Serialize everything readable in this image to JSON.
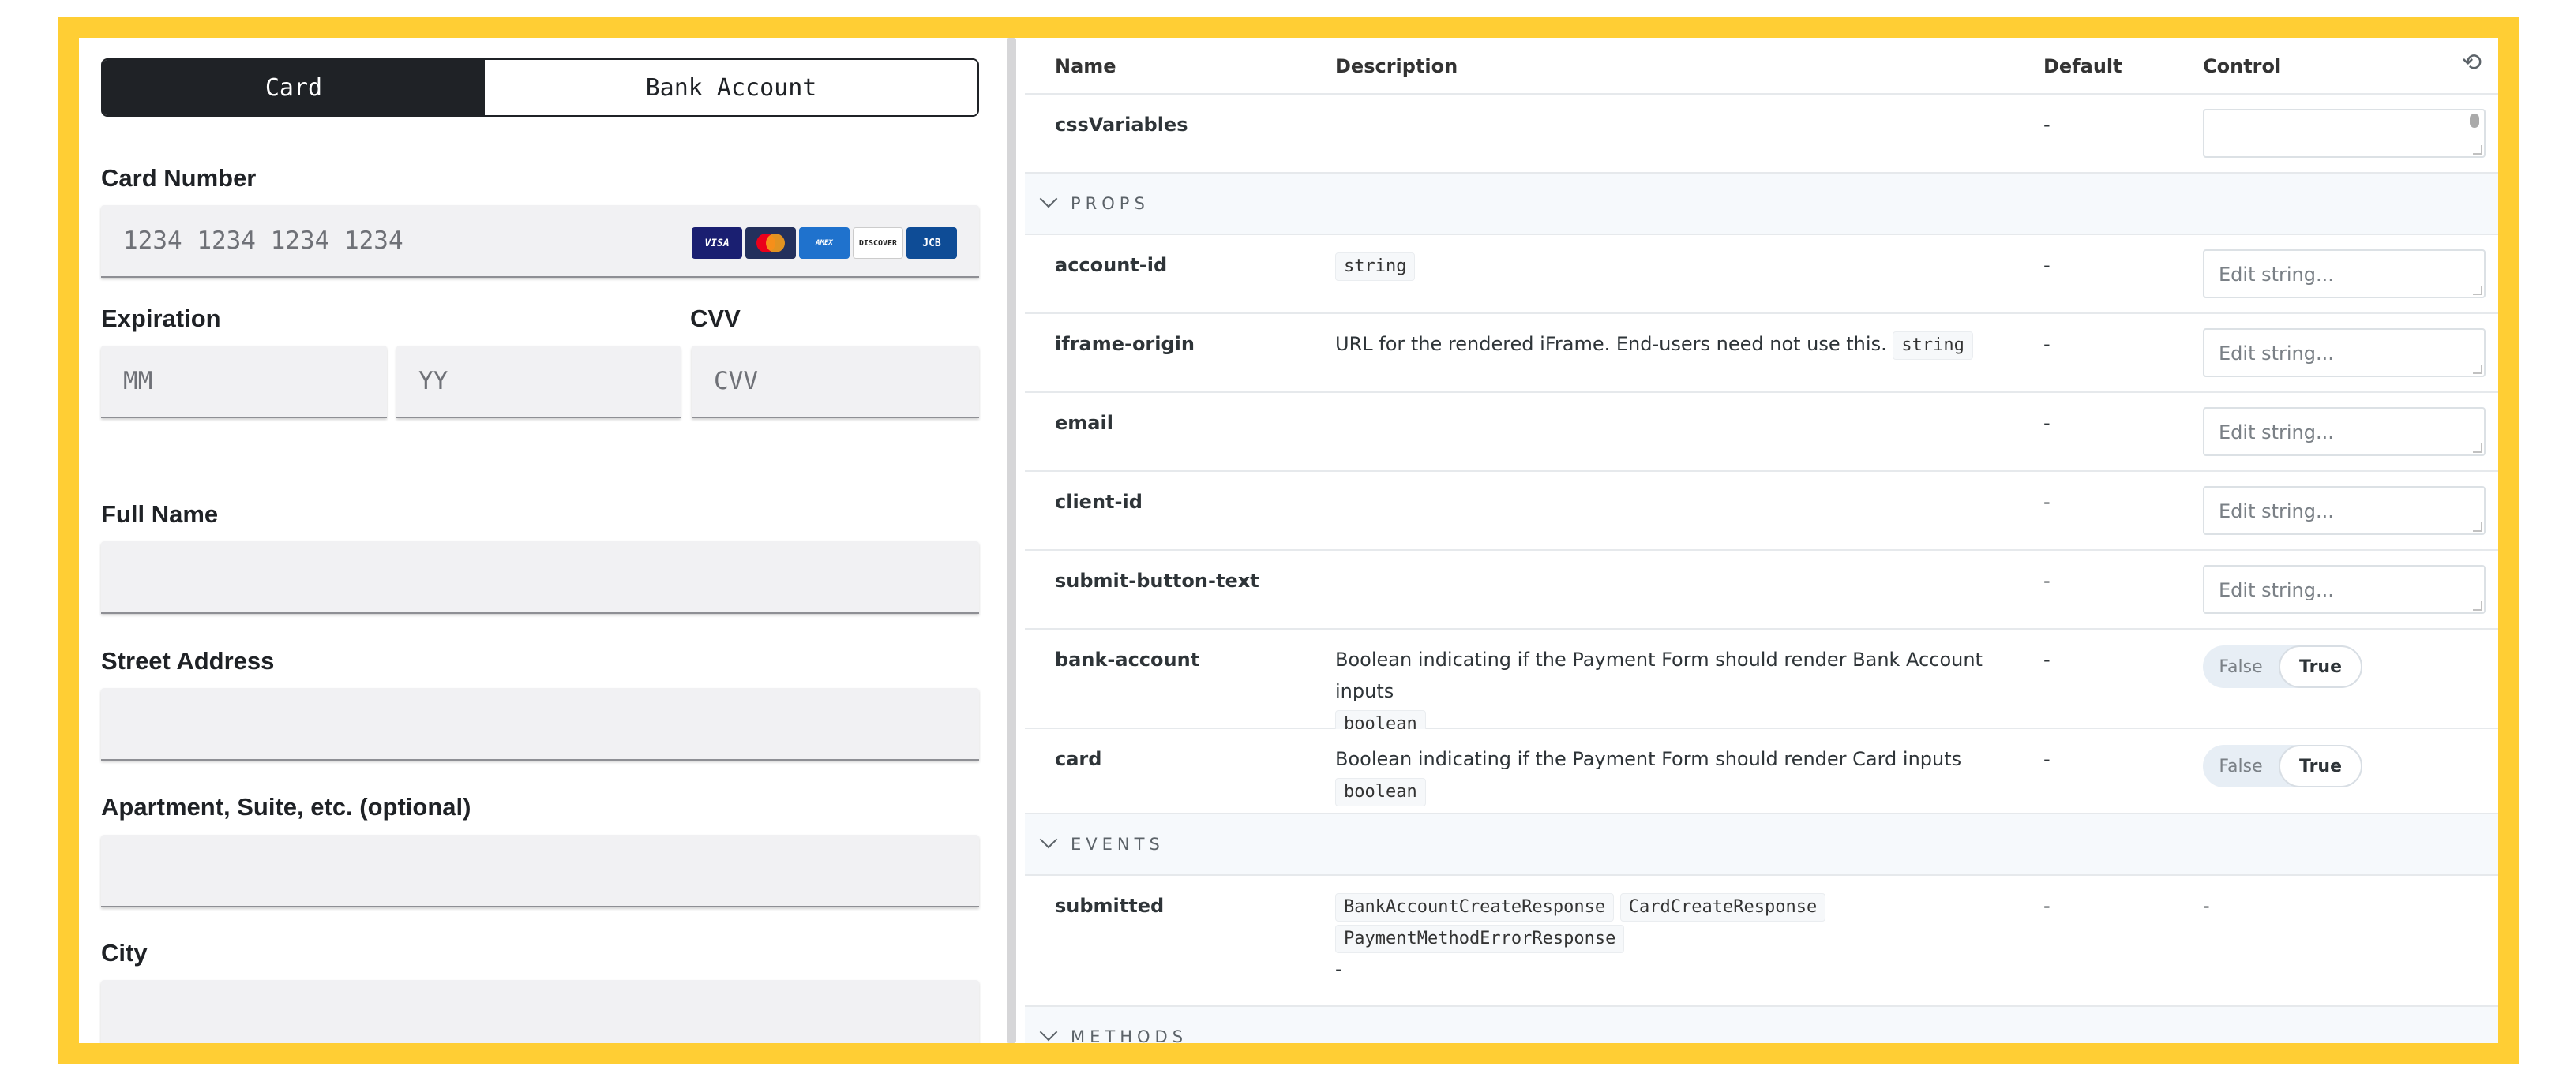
{
  "form": {
    "tabs": [
      "Card",
      "Bank Account"
    ],
    "card_number_label": "Card Number",
    "card_number_placeholder": "1234 1234 1234 1234",
    "card_brands": [
      "VISA",
      "Mastercard",
      "American Express",
      "DISCOVER",
      "JCB"
    ],
    "expiration_label": "Expiration",
    "month_placeholder": "MM",
    "year_placeholder": "YY",
    "cvv_label": "CVV",
    "cvv_placeholder": "CVV",
    "full_name_label": "Full Name",
    "street_label": "Street Address",
    "apt_label": "Apartment, Suite, etc. (optional)",
    "city_label": "City"
  },
  "table": {
    "headers": {
      "name": "Name",
      "description": "Description",
      "default": "Default",
      "control": "Control"
    },
    "rows_top": [
      {
        "name": "cssVariables",
        "default": "-"
      }
    ],
    "sections": {
      "props": "PROPS",
      "events": "EVENTS",
      "methods": "METHODS"
    },
    "props": [
      {
        "name": "account-id",
        "desc": "",
        "type": "string",
        "default": "-",
        "control": "Edit string..."
      },
      {
        "name": "iframe-origin",
        "desc": "URL for the rendered iFrame. End-users need not use this.",
        "type": "string",
        "default": "-",
        "control": "Edit string..."
      },
      {
        "name": "email",
        "default": "-",
        "control": "Edit string..."
      },
      {
        "name": "client-id",
        "default": "-",
        "control": "Edit string..."
      },
      {
        "name": "submit-button-text",
        "default": "-",
        "control": "Edit string..."
      },
      {
        "name": "bank-account",
        "desc": "Boolean indicating if the Payment Form should render Bank Account inputs",
        "type": "boolean",
        "default": "-",
        "toggle_off": "False",
        "toggle_on": "True"
      },
      {
        "name": "card",
        "desc": "Boolean indicating if the Payment Form should render Card inputs",
        "type": "boolean",
        "default": "-",
        "toggle_off": "False",
        "toggle_on": "True"
      }
    ],
    "events": [
      {
        "name": "submitted",
        "types": [
          "BankAccountCreateResponse",
          "CardCreateResponse",
          "PaymentMethodErrorResponse"
        ],
        "desc_dash": "-",
        "default": "-",
        "control": "-"
      }
    ]
  }
}
